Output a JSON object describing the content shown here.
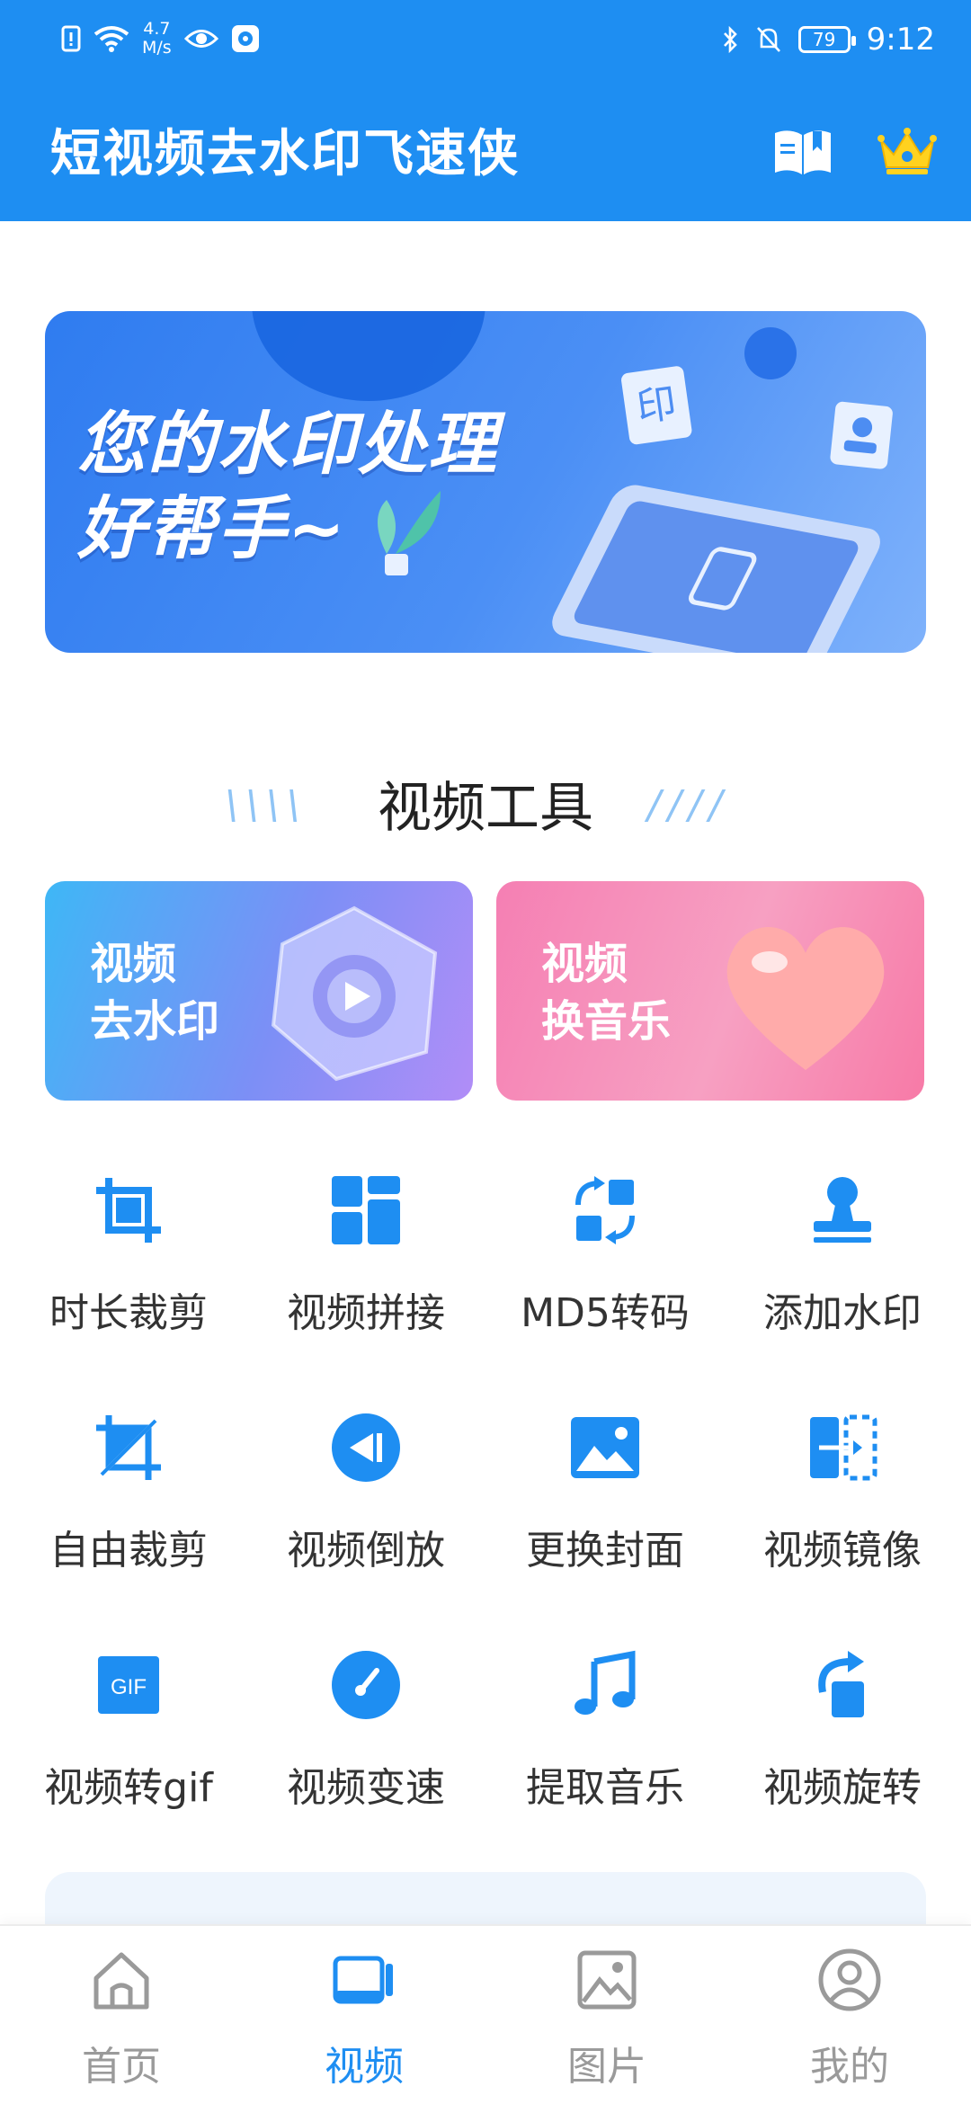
{
  "status_bar": {
    "network_speed_value": "4.7",
    "network_speed_unit": "M/s",
    "battery": "79",
    "time": "9:12"
  },
  "header": {
    "title": "短视频去水印飞速侠",
    "icons": [
      "guide-book-icon",
      "vip-crown-icon"
    ]
  },
  "banner": {
    "line1": "您的水印处理",
    "line2": "好帮手~"
  },
  "section": {
    "title": "视频工具"
  },
  "feature_cards": [
    {
      "line1": "视频",
      "line2": "去水印"
    },
    {
      "line1": "视频",
      "line2": "换音乐"
    }
  ],
  "tools": [
    {
      "label": "时长裁剪",
      "icon": "crop-icon"
    },
    {
      "label": "视频拼接",
      "icon": "grid-merge-icon"
    },
    {
      "label": "MD5转码",
      "icon": "transcode-icon"
    },
    {
      "label": "添加水印",
      "icon": "stamp-icon"
    },
    {
      "label": "自由裁剪",
      "icon": "free-crop-icon"
    },
    {
      "label": "视频倒放",
      "icon": "rewind-icon"
    },
    {
      "label": "更换封面",
      "icon": "image-cover-icon"
    },
    {
      "label": "视频镜像",
      "icon": "mirror-icon"
    },
    {
      "label": "视频转gif",
      "icon": "gif-icon"
    },
    {
      "label": "视频变速",
      "icon": "speedometer-icon"
    },
    {
      "label": "提取音乐",
      "icon": "music-note-icon"
    },
    {
      "label": "视频旋转",
      "icon": "rotate-icon"
    }
  ],
  "bottom_nav": [
    {
      "label": "首页",
      "icon": "home-icon"
    },
    {
      "label": "视频",
      "icon": "video-icon",
      "active": true
    },
    {
      "label": "图片",
      "icon": "image-icon"
    },
    {
      "label": "我的",
      "icon": "profile-icon"
    }
  ],
  "colors": {
    "primary": "#1e8ef2",
    "icon_blue": "#1e8ef2",
    "inactive": "#9a9a9a"
  }
}
